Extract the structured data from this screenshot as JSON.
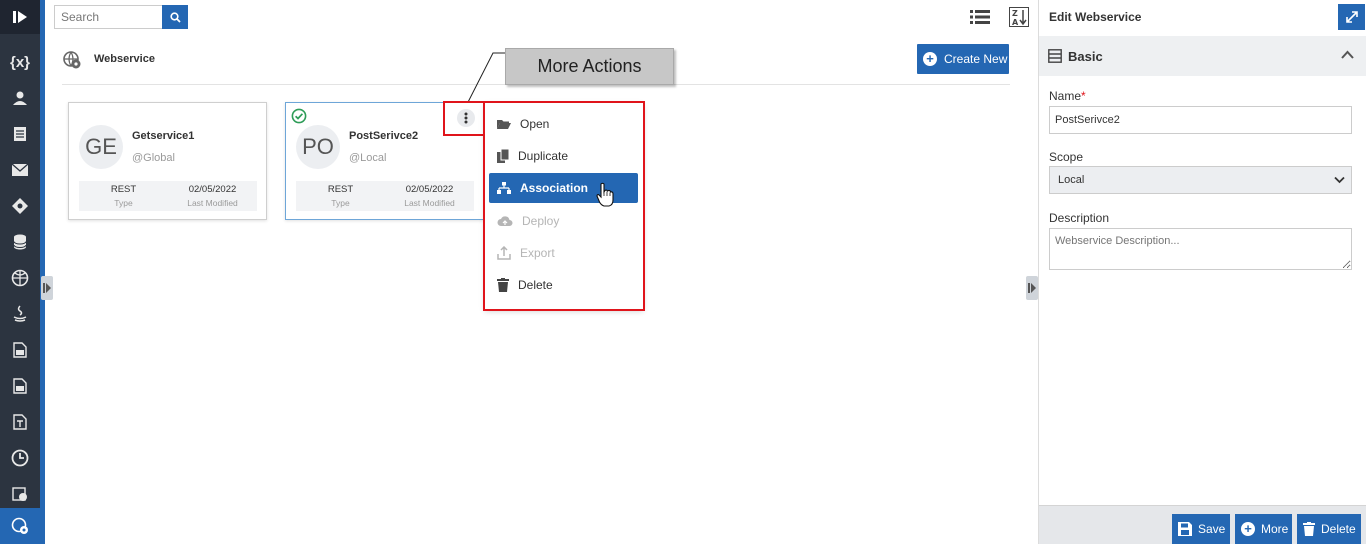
{
  "rail": {
    "vars_label": "{x}"
  },
  "search": {
    "placeholder": "Search"
  },
  "header": {
    "title": "Webservice",
    "create_label": "Create New"
  },
  "callout": {
    "text": "More Actions"
  },
  "cards": [
    {
      "initials": "GE",
      "name": "Getservice1",
      "scope": "@Global",
      "type": "REST",
      "type_label": "Type",
      "modified": "02/05/2022",
      "modified_label": "Last Modified"
    },
    {
      "initials": "PO",
      "name": "PostSerivce2",
      "scope": "@Local",
      "type": "REST",
      "type_label": "Type",
      "modified": "02/05/2022",
      "modified_label": "Last Modified"
    }
  ],
  "menu": {
    "items": [
      {
        "label": "Open",
        "icon": "folder-open-icon",
        "state": "normal"
      },
      {
        "label": "Duplicate",
        "icon": "copy-icon",
        "state": "normal"
      },
      {
        "label": "Association",
        "icon": "sitemap-icon",
        "state": "active"
      },
      {
        "label": "Deploy",
        "icon": "cloud-upload-icon",
        "state": "disabled"
      },
      {
        "label": "Export",
        "icon": "export-icon",
        "state": "disabled"
      },
      {
        "label": "Delete",
        "icon": "trash-icon",
        "state": "normal"
      }
    ]
  },
  "panel": {
    "title": "Edit Webservice",
    "section": "Basic",
    "name_label": "Name",
    "name_required": "*",
    "name_value": "PostSerivce2",
    "scope_label": "Scope",
    "scope_value": "Local",
    "description_label": "Description",
    "description_placeholder": "Webservice Description...",
    "footer": {
      "save": "Save",
      "more": "More",
      "delete": "Delete"
    }
  },
  "colors": {
    "accent": "#2467b3",
    "rail": "#2c3440",
    "highlight": "#e0141b",
    "success": "#2e9c57"
  }
}
